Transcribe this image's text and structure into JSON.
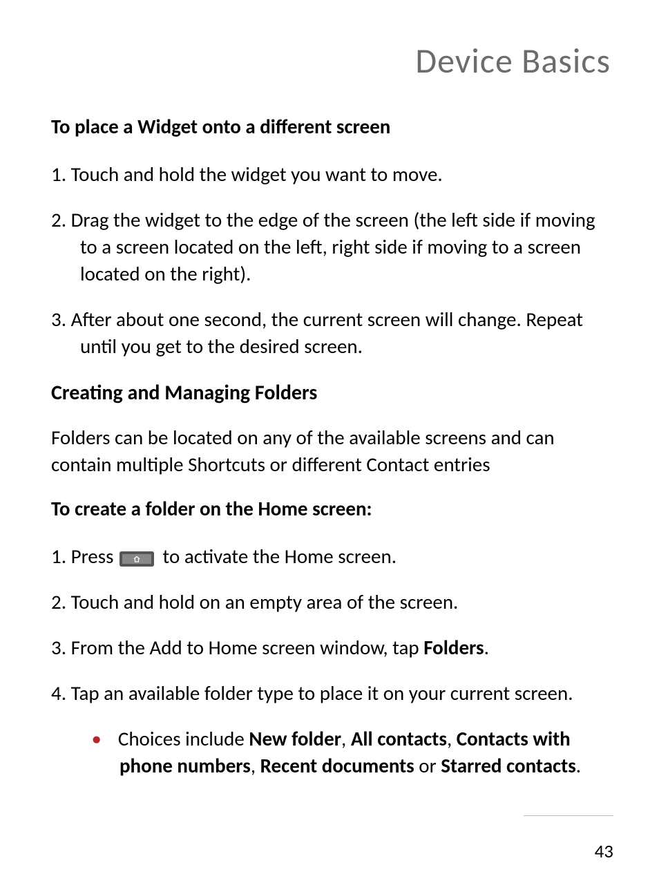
{
  "chapter_title": "Device Basics",
  "section1": {
    "heading": "To place a Widget onto a different screen",
    "steps": [
      "Touch and hold the widget you want to move.",
      "Drag the widget to the edge of the screen (the left side if moving to a screen located on the left, right side if moving to a screen located on the right).",
      "After about one second, the current screen will change. Repeat until you get to the desired screen."
    ]
  },
  "section2": {
    "heading": "Creating and Managing Folders",
    "intro": "Folders can be located on any of the available screens and can contain multiple Shortcuts or different Contact entries",
    "subheading": "To create a folder on the Home screen:",
    "step1_pre": "Press ",
    "step1_post": " to activate the Home screen.",
    "step2": "Touch and hold on an empty area of the screen.",
    "step3_pre": "From the Add to Home screen window, tap ",
    "step3_bold": "Folders",
    "step3_post": ".",
    "step4": "Tap an available folder type to place it on your current screen.",
    "bullet_pre": "Choices include ",
    "bullet_b1": "New folder",
    "bullet_s1": ", ",
    "bullet_b2": "All contacts",
    "bullet_s2": ", ",
    "bullet_b3": "Contacts with phone numbers",
    "bullet_s3": ", ",
    "bullet_b4": "Recent documents",
    "bullet_s4": " or ",
    "bullet_b5": "Starred contacts",
    "bullet_s5": "."
  },
  "page_number": "43"
}
